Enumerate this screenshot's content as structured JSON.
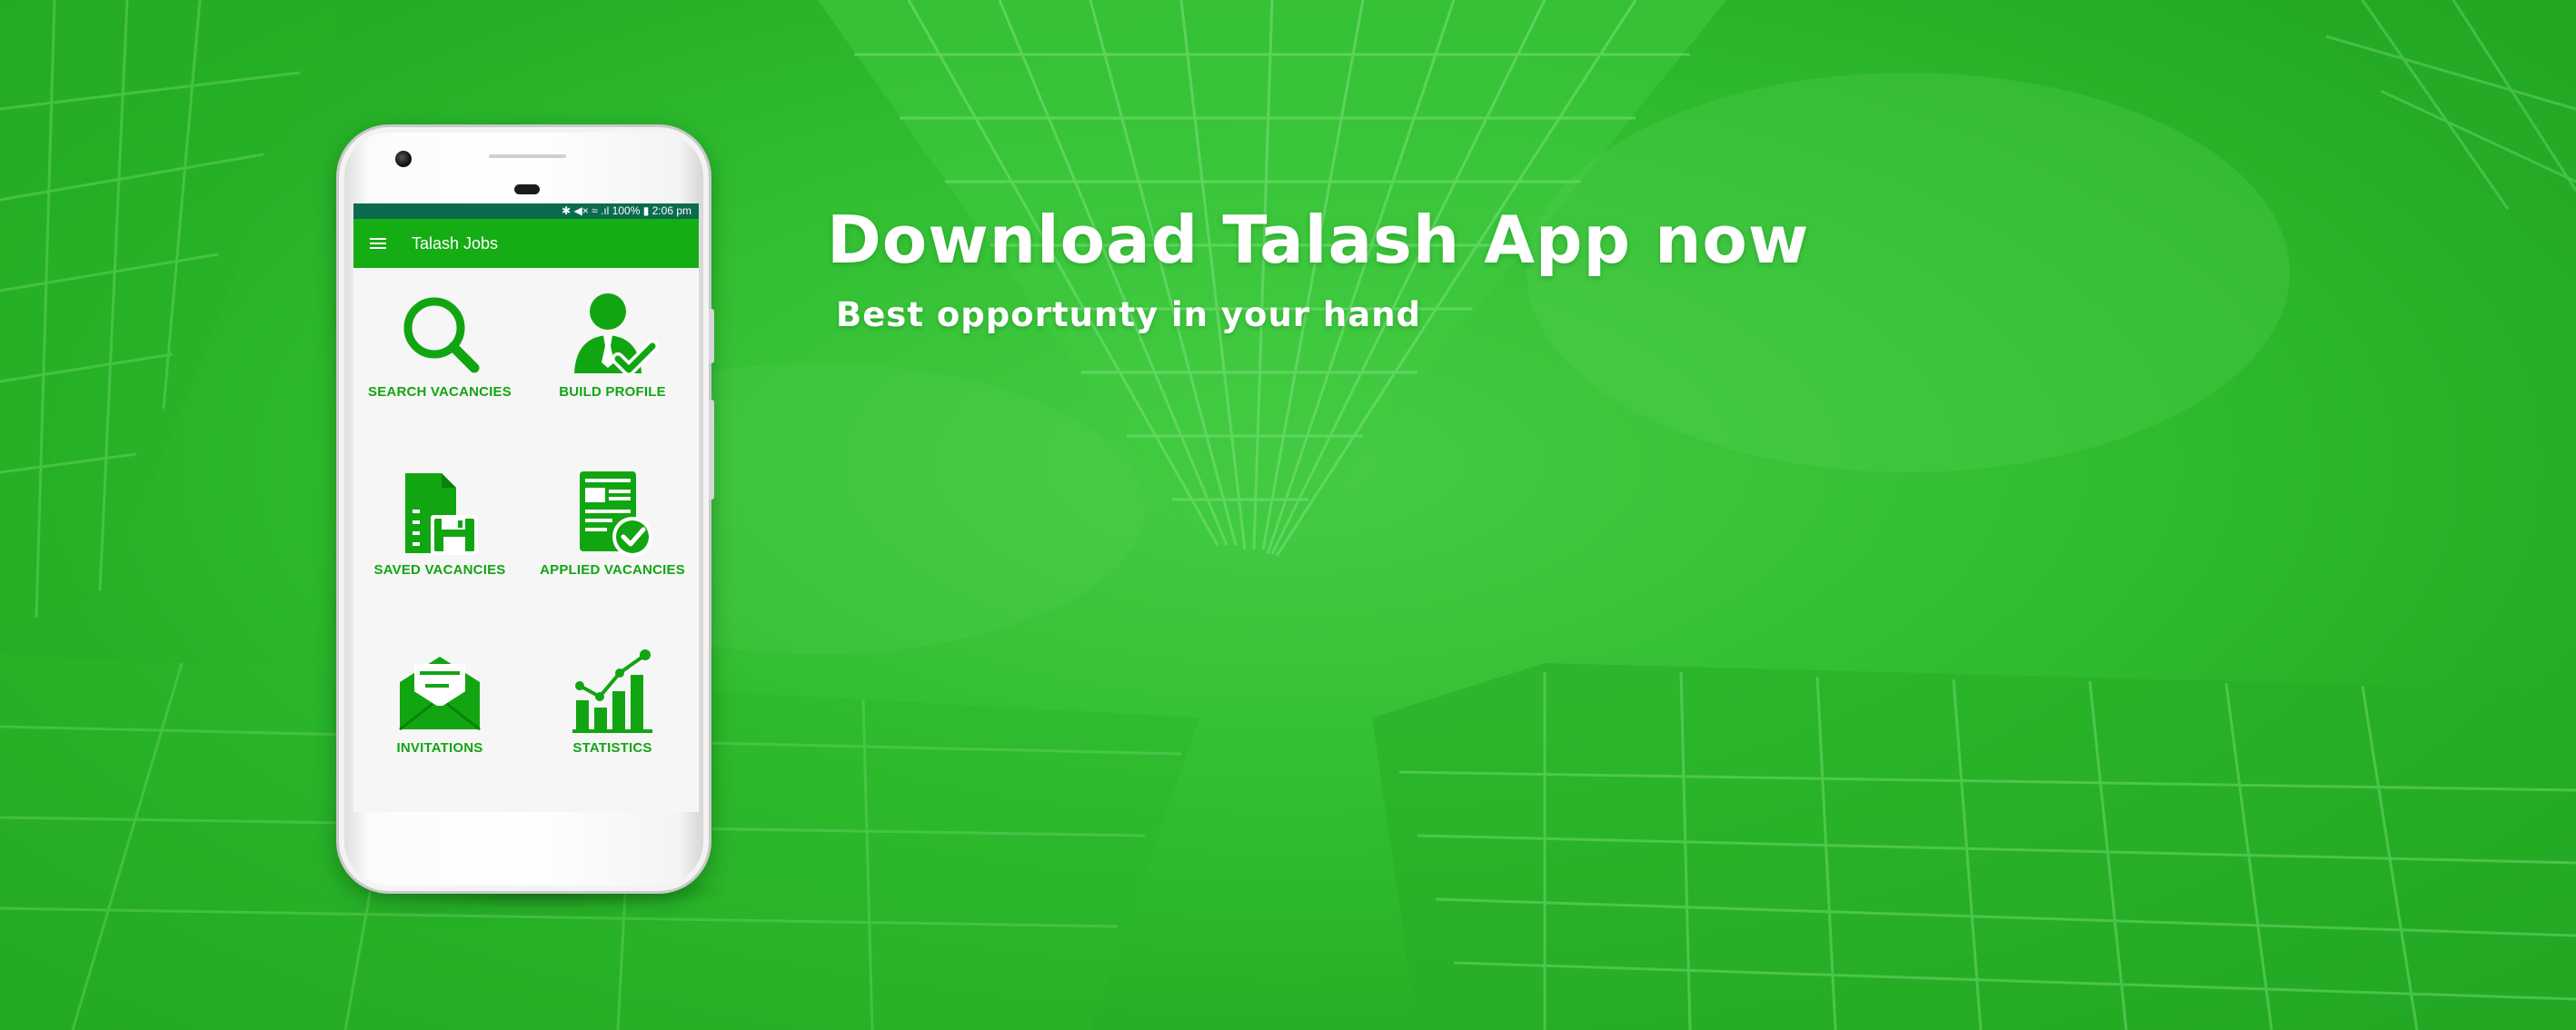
{
  "banner": {
    "headline": "Download Talash App now",
    "subline": "Best opportunty in your hand"
  },
  "phone": {
    "status_bar": "✱ ◀× ≈ .ıl 100% ▮ 2:06 pm",
    "app_title": "Talash Jobs",
    "menu_icon": "hamburger-menu-icon",
    "tiles": [
      {
        "label": "SEARCH VACANCIES",
        "icon": "search-icon"
      },
      {
        "label": "BUILD PROFILE",
        "icon": "user-check-icon"
      },
      {
        "label": "SAVED VACANCIES",
        "icon": "document-save-icon"
      },
      {
        "label": "APPLIED VACANCIES",
        "icon": "document-check-icon"
      },
      {
        "label": "INVITATIONS",
        "icon": "envelope-open-icon"
      },
      {
        "label": "STATISTICS",
        "icon": "chart-growth-icon"
      }
    ]
  },
  "colors": {
    "background": "#2fbf2f",
    "app_bar": "#14ad14",
    "status_bar": "#0b6b4e",
    "icon_green": "#12a512",
    "text": "#ffffff"
  }
}
